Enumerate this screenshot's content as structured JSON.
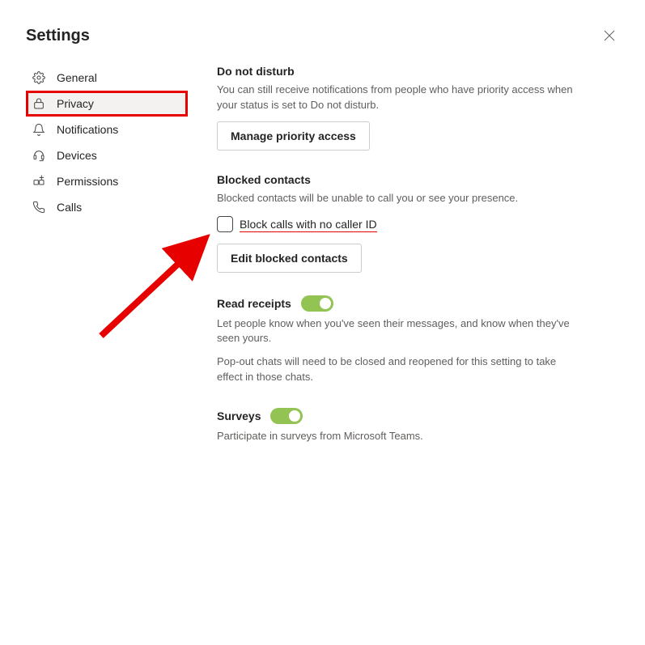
{
  "title": "Settings",
  "sidebar": {
    "items": [
      {
        "label": "General",
        "icon": "gear"
      },
      {
        "label": "Privacy",
        "icon": "lock",
        "selected": true
      },
      {
        "label": "Notifications",
        "icon": "bell"
      },
      {
        "label": "Devices",
        "icon": "headset"
      },
      {
        "label": "Permissions",
        "icon": "app"
      },
      {
        "label": "Calls",
        "icon": "phone"
      }
    ]
  },
  "sections": {
    "dnd": {
      "title": "Do not disturb",
      "desc": "You can still receive notifications from people who have priority access when your status is set to Do not disturb.",
      "button": "Manage priority access"
    },
    "blocked": {
      "title": "Blocked contacts",
      "desc": "Blocked contacts will be unable to call you or see your presence.",
      "checkbox_label": "Block calls with no caller ID",
      "checkbox_checked": false,
      "button": "Edit blocked contacts"
    },
    "read_receipts": {
      "title": "Read receipts",
      "toggle": true,
      "desc": "Let people know when you've seen their messages, and know when they've seen yours.",
      "desc2": "Pop-out chats will need to be closed and reopened for this setting to take effect in those chats."
    },
    "surveys": {
      "title": "Surveys",
      "toggle": true,
      "desc": "Participate in surveys from Microsoft Teams."
    }
  },
  "annotation": {
    "arrow_color": "#e60000"
  }
}
